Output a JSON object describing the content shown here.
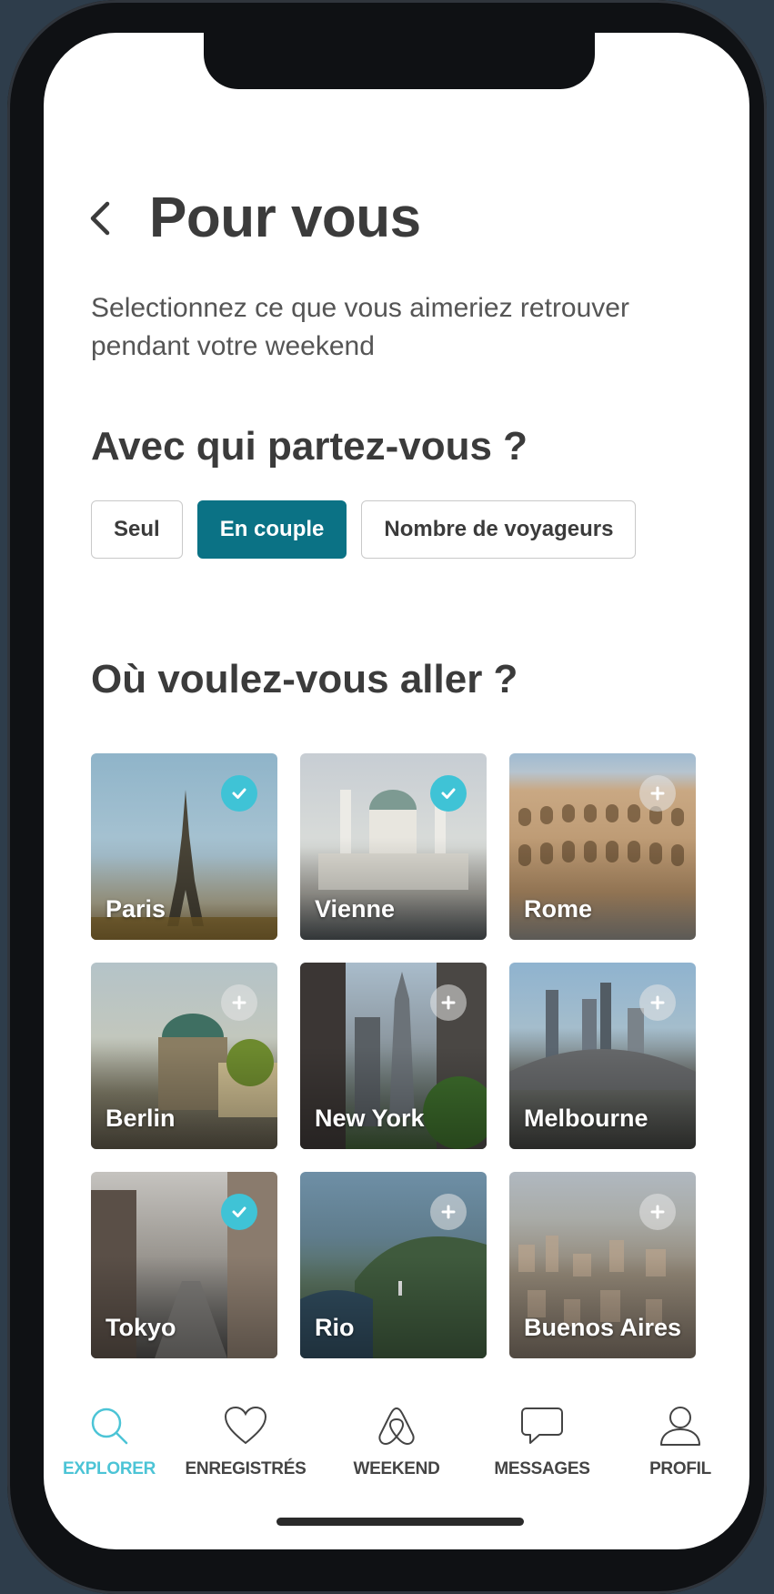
{
  "header": {
    "title": "Pour vous"
  },
  "subtitle": "Selectionnez ce que vous aimeriez retrouver pendant votre weekend",
  "companions": {
    "title": "Avec qui partez-vous ?",
    "options": [
      {
        "label": "Seul",
        "selected": false
      },
      {
        "label": "En couple",
        "selected": true
      },
      {
        "label": "Nombre de voyageurs",
        "selected": false
      }
    ]
  },
  "destinations": {
    "title": "Où voulez-vous aller ?",
    "items": [
      {
        "name": "Paris",
        "selected": true
      },
      {
        "name": "Vienne",
        "selected": true
      },
      {
        "name": "Rome",
        "selected": false
      },
      {
        "name": "Berlin",
        "selected": false
      },
      {
        "name": "New York",
        "selected": false
      },
      {
        "name": "Melbourne",
        "selected": false
      },
      {
        "name": "Tokyo",
        "selected": true
      },
      {
        "name": "Rio",
        "selected": false
      },
      {
        "name": "Buenos Aires",
        "selected": false
      }
    ]
  },
  "tabbar": {
    "items": [
      {
        "label": "EXPLORER",
        "icon": "search-icon",
        "active": true
      },
      {
        "label": "ENREGISTRÉS",
        "icon": "heart-icon",
        "active": false
      },
      {
        "label": "WEEKEND",
        "icon": "airbnb-logo-icon",
        "active": false
      },
      {
        "label": "MESSAGES",
        "icon": "message-icon",
        "active": false
      },
      {
        "label": "PROFIL",
        "icon": "user-icon",
        "active": false
      }
    ]
  },
  "colors": {
    "accent": "#0b7285",
    "check": "#3fc3d6",
    "active_tab": "#4cc4d6"
  }
}
